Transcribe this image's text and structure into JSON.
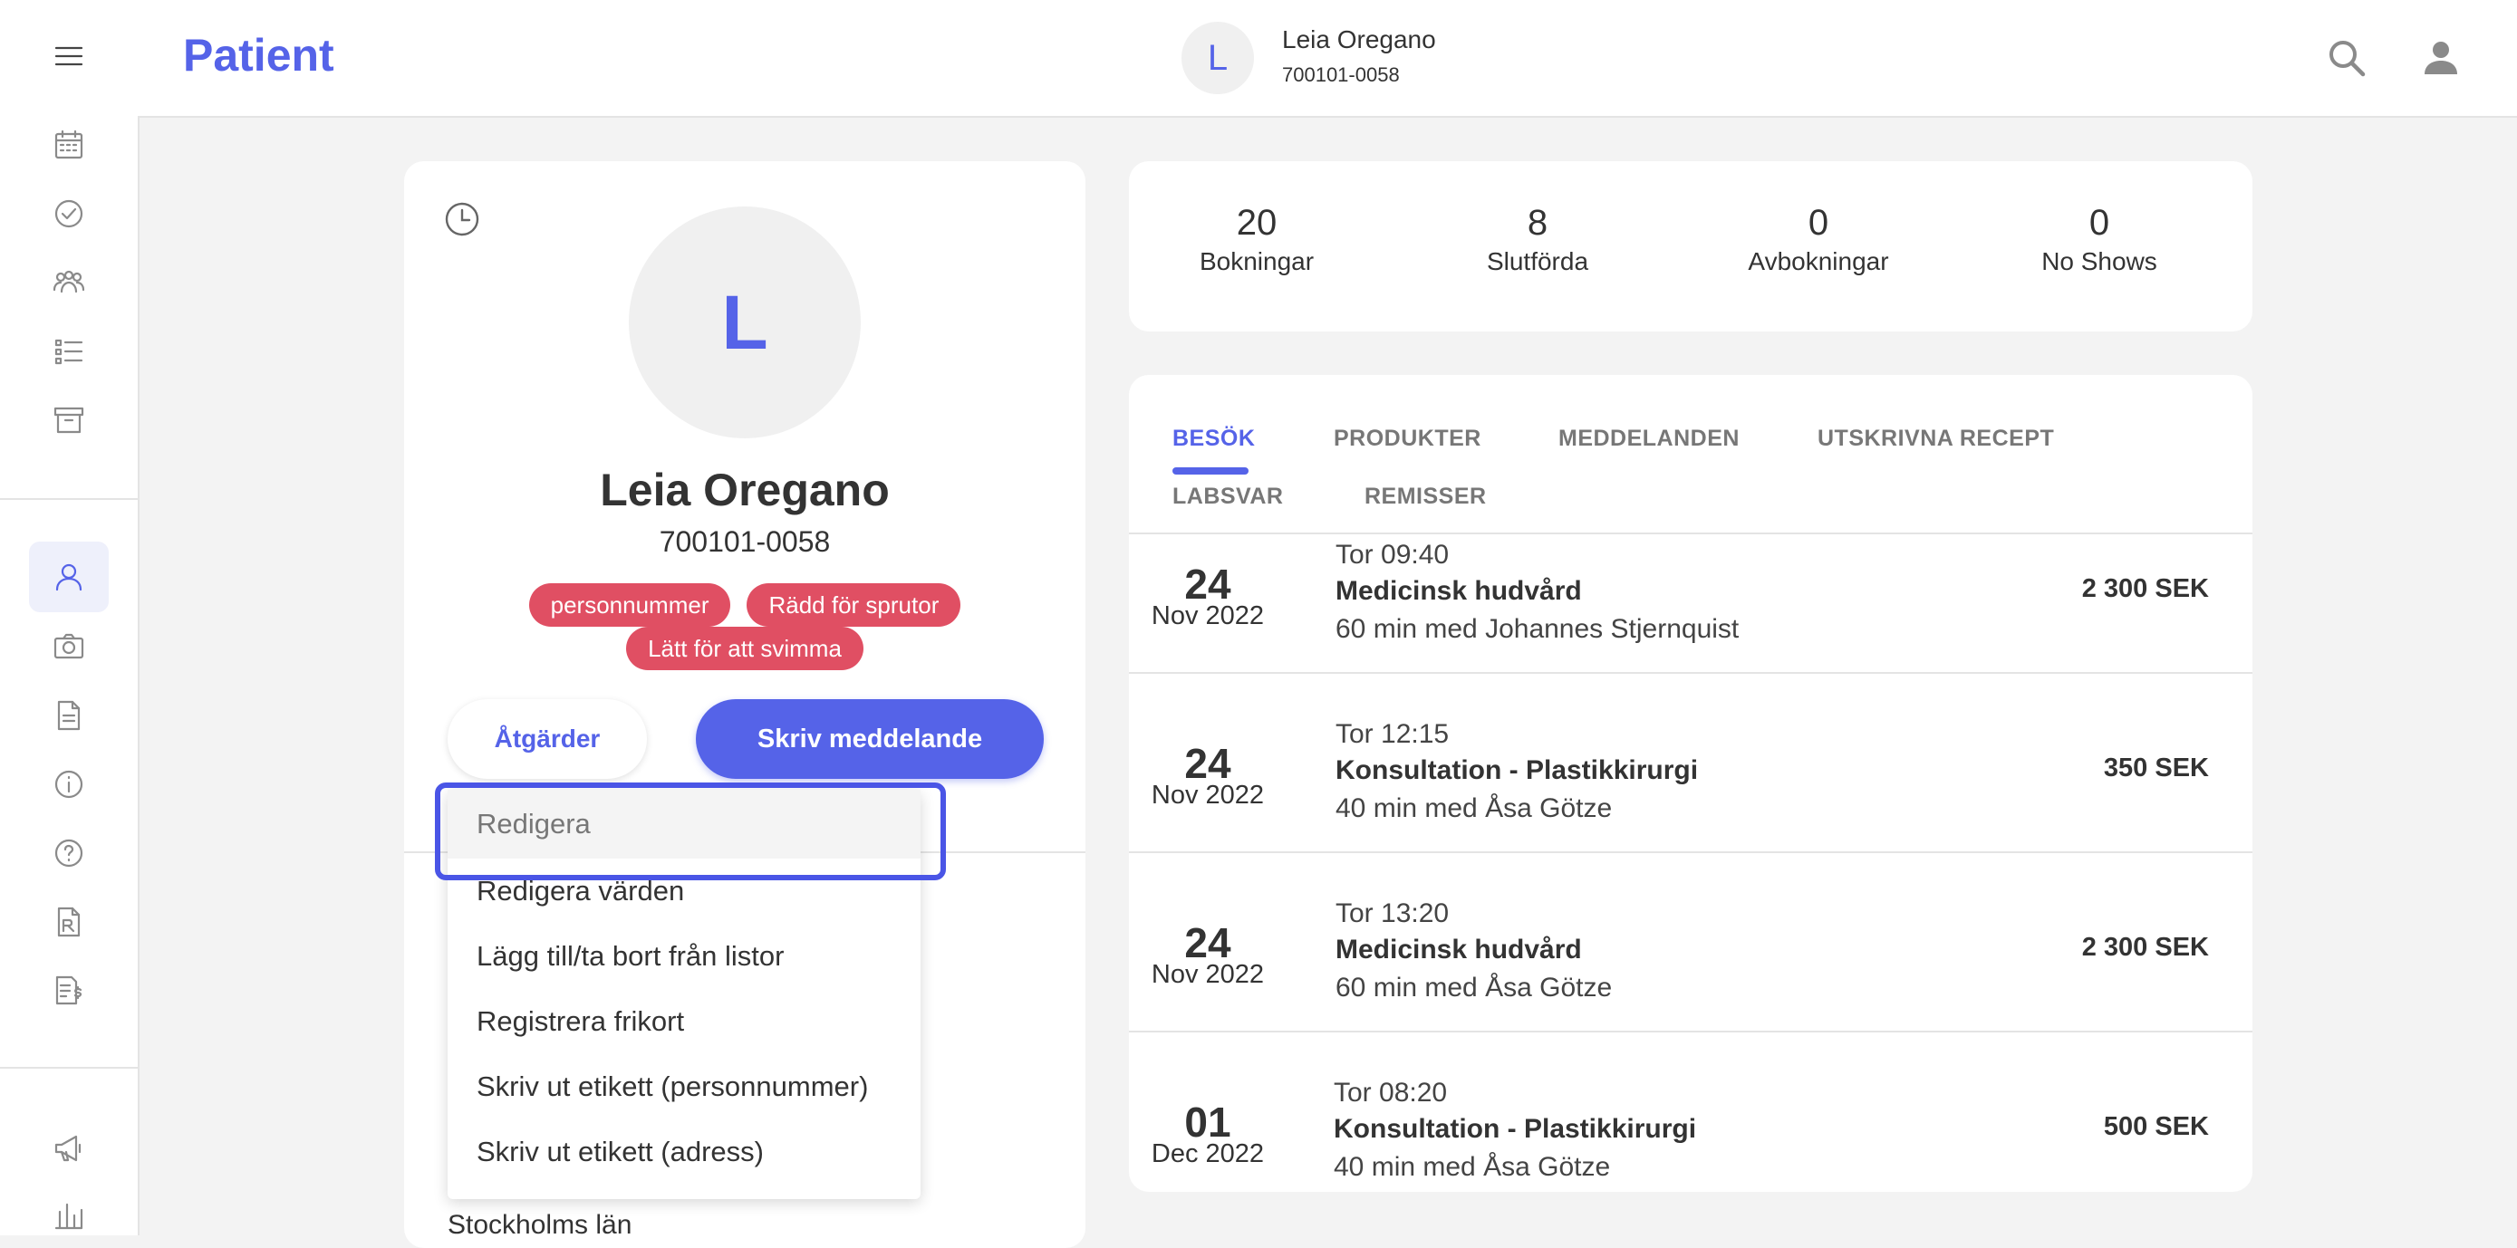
{
  "header": {
    "title": "Patient",
    "patient_initial": "L",
    "patient_name": "Leia Oregano",
    "patient_pnr": "700101-0058"
  },
  "rail": {
    "icons": [
      "menu-icon",
      "calendar-icon",
      "check-circle-icon",
      "group-icon",
      "list-icon",
      "archive-icon",
      "user-icon",
      "camera-icon",
      "document-icon",
      "info-icon",
      "help-icon",
      "prescription-icon",
      "invoice-icon",
      "megaphone-icon",
      "bar-chart-icon"
    ],
    "active": "user-icon"
  },
  "patient": {
    "initial": "L",
    "name": "Leia Oregano",
    "pnr": "700101-0058",
    "tags": [
      "personnummer",
      "Rädd för sprutor",
      "Lätt för att svimma"
    ],
    "actions_label": "Åtgärder",
    "message_label": "Skriv meddelande",
    "county": "Stockholms län"
  },
  "actions_menu": {
    "items": [
      "Redigera",
      "Redigera värden",
      "Lägg till/ta bort från listor",
      "Registrera frikort",
      "Skriv ut etikett (personnummer)",
      "Skriv ut etikett (adress)"
    ],
    "highlighted": "Redigera"
  },
  "stats": [
    {
      "value": "20",
      "label": "Bokningar"
    },
    {
      "value": "8",
      "label": "Slutförda"
    },
    {
      "value": "0",
      "label": "Avbokningar"
    },
    {
      "value": "0",
      "label": "No Shows"
    }
  ],
  "tabs": [
    {
      "label": "BESÖK",
      "active": true
    },
    {
      "label": "PRODUKTER",
      "active": false
    },
    {
      "label": "MEDDELANDEN",
      "active": false
    },
    {
      "label": "UTSKRIVNA RECEPT",
      "active": false
    },
    {
      "label": "LABSVAR",
      "active": false
    },
    {
      "label": "REMISSER",
      "active": false
    }
  ],
  "visits": [
    {
      "day": "24",
      "month": "Nov 2022",
      "time": "Tor 09:40",
      "service": "Medicinsk hudvård",
      "duration": "60 min med Johannes Stjernquist",
      "price": "2 300 SEK"
    },
    {
      "day": "24",
      "month": "Nov 2022",
      "time": "Tor 12:15",
      "service": "Konsultation - Plastikkirurgi",
      "duration": "40 min med Åsa Götze",
      "price": "350 SEK"
    },
    {
      "day": "24",
      "month": "Nov 2022",
      "time": "Tor 13:20",
      "service": "Medicinsk hudvård",
      "duration": "60 min med Åsa Götze",
      "price": "2 300 SEK"
    },
    {
      "day": "01",
      "month": "Dec 2022",
      "time": "Tor 08:20",
      "service": "Konsultation - Plastikkirurgi",
      "duration": "40 min med Åsa Götze",
      "price": "500 SEK"
    }
  ],
  "colors": {
    "accent": "#5563e8",
    "tag": "#e04f63",
    "background": "#f3f3f3"
  }
}
